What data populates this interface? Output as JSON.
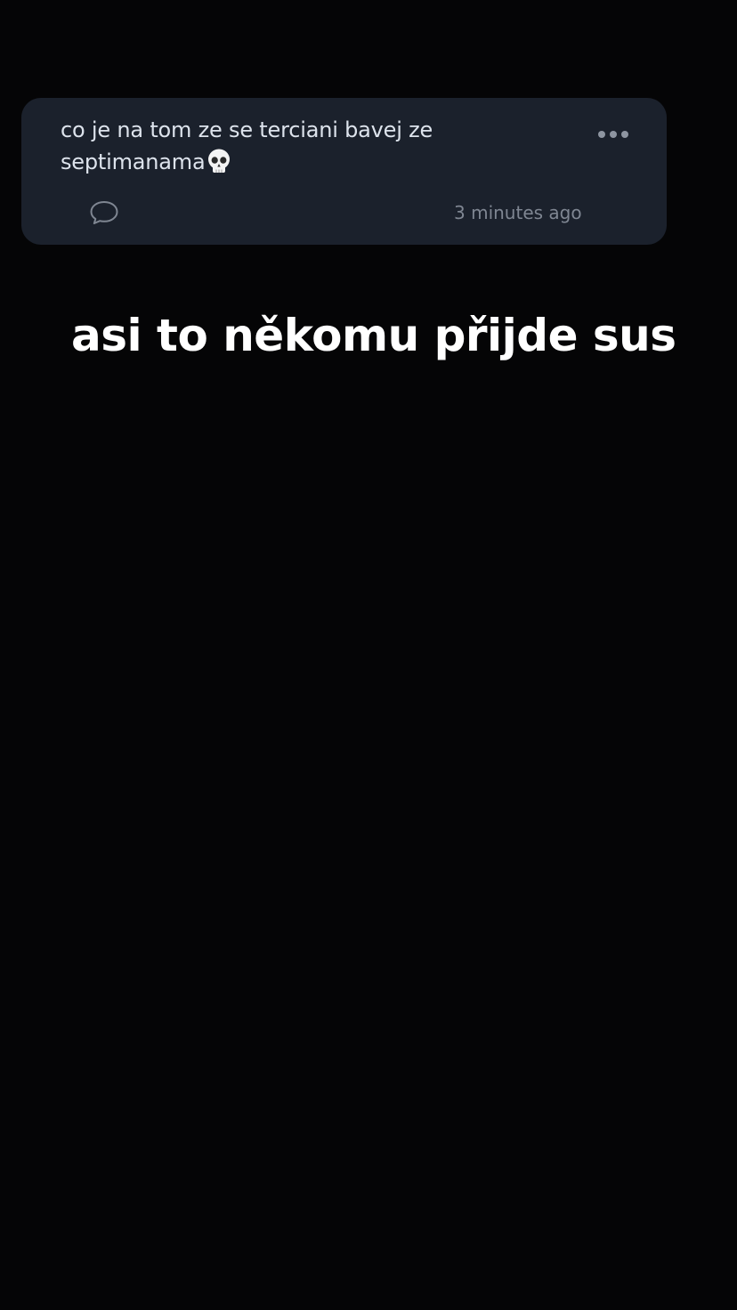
{
  "post": {
    "message": "co je na tom ze se terciani bavej ze septimanama",
    "emoji": "skull-emoji",
    "timestamp": "3 minutes ago",
    "icons": {
      "more": "more-horizontal-icon",
      "comment": "comment-bubble-icon"
    }
  },
  "story": {
    "caption": "asi to někomu přijde sus"
  },
  "colors": {
    "background": "#050506",
    "card": "#1b212c",
    "message_text": "#dde3ec",
    "muted": "#7f8692",
    "caption": "#ffffff"
  }
}
